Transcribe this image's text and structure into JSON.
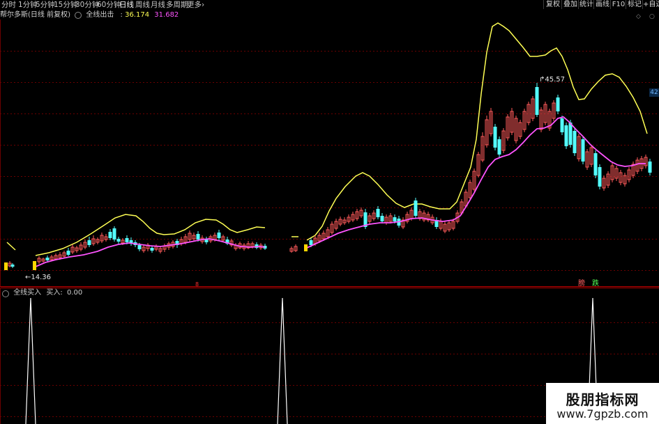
{
  "toolbar": {
    "periods": [
      "分时",
      "1分钟",
      "5分钟",
      "15分钟",
      "30分钟",
      "60分钟",
      "日线",
      "周线",
      "月线",
      "多周期",
      "更多"
    ],
    "active_period": "日线",
    "more_arrow": "›",
    "right_buttons": [
      "复权",
      "叠加",
      "统计",
      "画线",
      "F10",
      "标记",
      "+自选"
    ]
  },
  "main_panel": {
    "stock_title": "帮尔多斯(日线 前复权)",
    "indicator_name": "全线出击",
    "value1": "36.174",
    "value2": "31.682",
    "max_label": "45.57",
    "min_label": "14.36",
    "price_badge": "42",
    "rise_label": "膀",
    "fall_label": "跌",
    "small_mark": "8"
  },
  "indicator_panel": {
    "name": "全线买入",
    "label": "买入:",
    "value": "0.00"
  },
  "watermark": {
    "title": "股朋指标网",
    "url": "www.7gpzb.com"
  },
  "colors": {
    "up": "#ff5a5a",
    "down": "#54ffff",
    "upper_band": "#ffff54",
    "mid_line": "#ff54ff",
    "grid": "#6b0000",
    "signal": "#ffd700"
  },
  "chart_data": {
    "type": "candlestick",
    "price_range": [
      14.36,
      45.57
    ],
    "series": [
      {
        "name": "全线出击",
        "value": 36.174
      },
      {
        "name": "",
        "value": 31.682
      }
    ],
    "signal_peaks": 3
  }
}
